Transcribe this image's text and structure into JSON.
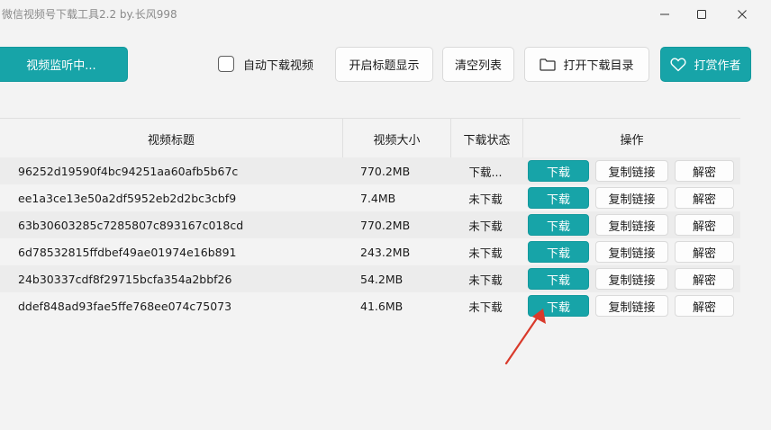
{
  "window": {
    "title": "微信视频号下载工具2.2 by.长风998",
    "controls": [
      "minimize-icon",
      "maximize-icon",
      "close-icon"
    ]
  },
  "toolbar": {
    "monitor_label": "视频监听中...",
    "auto_download_label": "自动下载视频",
    "auto_download_checked": false,
    "show_title_label": "开启标题显示",
    "clear_list_label": "清空列表",
    "open_dir_label": "打开下载目录",
    "open_dir_icon": "folder-icon",
    "tip_label": "打赏作者",
    "tip_icon": "heart-icon"
  },
  "table": {
    "headers": {
      "title": "视频标题",
      "size": "视频大小",
      "status": "下载状态",
      "actions": "操作"
    },
    "action_labels": {
      "download": "下载",
      "copy_link": "复制链接",
      "decrypt": "解密"
    },
    "rows": [
      {
        "title": "96252d19590f4bc94251aa60afb5b67c",
        "size": "770.2MB",
        "status": "下载..."
      },
      {
        "title": "ee1a3ce13e50a2df5952eb2d2bc3cbf9",
        "size": "7.4MB",
        "status": "未下载"
      },
      {
        "title": "63b30603285c7285807c893167c018cd",
        "size": "770.2MB",
        "status": "未下载"
      },
      {
        "title": "6d78532815ffdbef49ae01974e16b891",
        "size": "243.2MB",
        "status": "未下载"
      },
      {
        "title": "24b30337cdf8f29715bcfa354a2bbf26",
        "size": "54.2MB",
        "status": "未下载"
      },
      {
        "title": "ddef848ad93fae5ffe768ee074c75073",
        "size": "41.6MB",
        "status": "未下载"
      }
    ]
  },
  "colors": {
    "accent": "#17a4a8",
    "arrow": "#d93a2b"
  }
}
